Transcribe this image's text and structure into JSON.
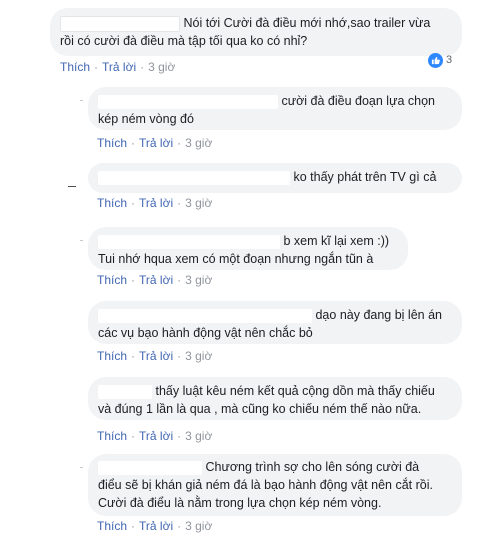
{
  "comments": [
    {
      "line1": "Nói tới Cười đà điều mới nhớ,sao trailer vừa",
      "line2": "rồi có cười đà điều mà tập tối qua ko có nhỉ?",
      "like": "Thích",
      "reply": "Trả lời",
      "time": "3 giờ",
      "reactions": "3"
    },
    {
      "line1": "cười đà điều đoạn lựa chọn",
      "line2": "kép ném vòng đó",
      "like": "Thích",
      "reply": "Trả lời",
      "time": "3 giờ"
    },
    {
      "line1": "ko thấy phát trên TV gì cả",
      "like": "Thích",
      "reply": "Trả lời",
      "time": "3 giờ"
    },
    {
      "line1": "b xem kĩ lại xem :))",
      "line2": "Tui nhớ hqua xem có một đoạn nhưng ngắn tũn à",
      "like": "Thích",
      "reply": "Trả lời",
      "time": "3 giờ"
    },
    {
      "line1": "dạo này đang bị lên án",
      "line2": "các vụ bạo hành động vật nên chắc bỏ",
      "like": "Thích",
      "reply": "Trả lời",
      "time": "3 giờ"
    },
    {
      "line1": "thấy luật kêu ném kết quả cộng dồn mà thấy chiếu",
      "line2": "và đúng 1 lần là qua , mà cũng ko chiếu ném thế nào nữa.",
      "like": "Thích",
      "reply": "Trả lời",
      "time": "3 giờ"
    },
    {
      "line1": "Chương trình sợ cho lên sóng cười đà",
      "line2": "điểu sẽ bị khán giả ném đá là bạo hành động vật nên cắt rồi.",
      "line3": "Cười đà điểu là nằm trong lựa chọn kép ném vòng.",
      "like": "Thích",
      "reply": "Trả lời",
      "time": "3 giờ"
    }
  ],
  "colors": {
    "link": "#4267b2",
    "bubble": "#f2f3f5",
    "like_badge": "#2d88ff"
  },
  "icons": {
    "reaction": "like-icon"
  }
}
